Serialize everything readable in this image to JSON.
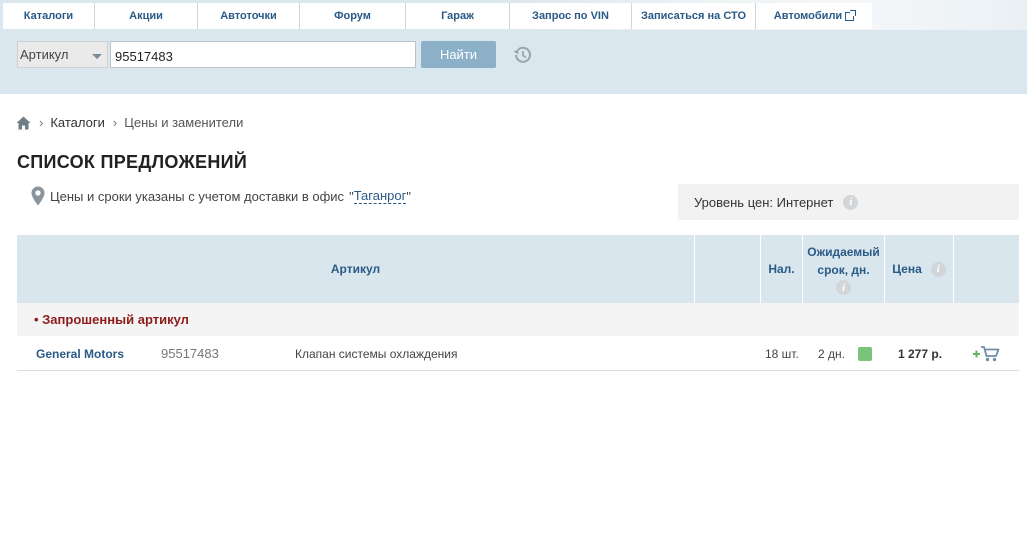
{
  "nav": {
    "items": [
      "Каталоги",
      "Акции",
      "Автоточки",
      "Форум",
      "Гараж",
      "Запрос по VIN",
      "Записаться на СТО",
      "Автомобили"
    ]
  },
  "search": {
    "type_selected": "Артикул",
    "value": "95517483",
    "button_label": "Найти"
  },
  "breadcrumb": {
    "items": [
      "Каталоги",
      "Цены и заменители"
    ]
  },
  "page": {
    "title": "СПИСОК ПРЕДЛОЖЕНИЙ",
    "delivery_text": "Цены и сроки указаны с учетом доставки в офис",
    "office": "Таганрог",
    "price_level": "Уровень цен: Интернет"
  },
  "table": {
    "headers": {
      "article": "Артикул",
      "availability": "Нал.",
      "expected_line1": "Ожидаемый",
      "expected_line2": "срок, дн.",
      "price": "Цена"
    },
    "group_label": "• Запрошенный артикул",
    "rows": [
      {
        "brand": "General Motors",
        "article": "95517483",
        "description": "Клапан системы охлаждения",
        "quantity": "18 шт.",
        "days": "2 дн.",
        "price": "1 277 р."
      }
    ]
  },
  "colors": {
    "accent": "#2a5a86",
    "topbar_bg": "#dbe7ee",
    "button_bg": "#8cb0c7",
    "group_label": "#8c1b1b",
    "availability_ok": "#7ac37a"
  }
}
